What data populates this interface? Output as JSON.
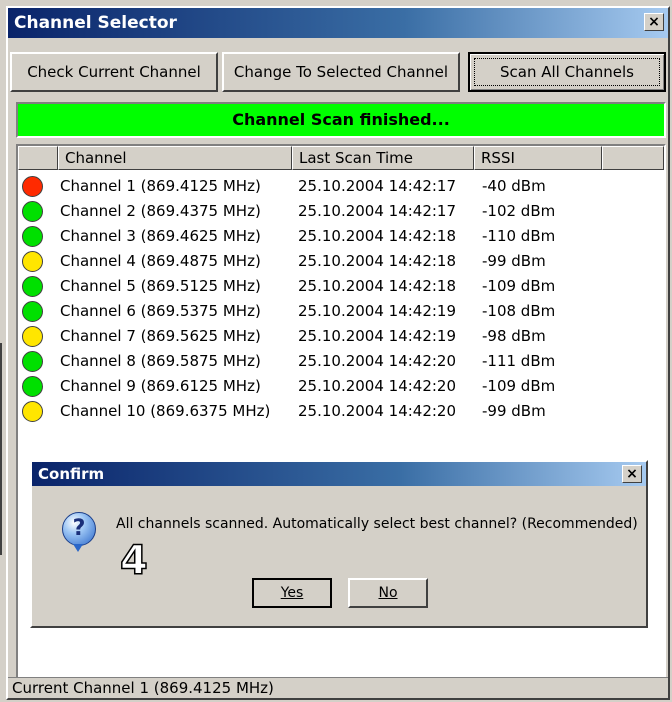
{
  "window": {
    "title": "Channel Selector",
    "close_glyph": "×"
  },
  "toolbar": {
    "check_label": "Check Current Channel",
    "change_label": "Change To Selected Channel",
    "scan_label": "Scan All Channels"
  },
  "scan_status": "Channel Scan finished...",
  "table": {
    "headers": [
      "Channel",
      "Last Scan Time",
      "RSSI",
      ""
    ],
    "rows": [
      {
        "status": "red",
        "channel": "Channel 1 (869.4125 MHz)",
        "time": "25.10.2004 14:42:17",
        "rssi": "-40 dBm"
      },
      {
        "status": "green",
        "channel": "Channel 2 (869.4375 MHz)",
        "time": "25.10.2004 14:42:17",
        "rssi": "-102 dBm"
      },
      {
        "status": "green",
        "channel": "Channel 3 (869.4625 MHz)",
        "time": "25.10.2004 14:42:18",
        "rssi": "-110 dBm"
      },
      {
        "status": "yellow",
        "channel": "Channel 4 (869.4875 MHz)",
        "time": "25.10.2004 14:42:18",
        "rssi": "-99 dBm"
      },
      {
        "status": "green",
        "channel": "Channel 5 (869.5125 MHz)",
        "time": "25.10.2004 14:42:18",
        "rssi": "-109 dBm"
      },
      {
        "status": "green",
        "channel": "Channel 6 (869.5375 MHz)",
        "time": "25.10.2004 14:42:19",
        "rssi": "-108 dBm"
      },
      {
        "status": "yellow",
        "channel": "Channel 7 (869.5625 MHz)",
        "time": "25.10.2004 14:42:19",
        "rssi": "-98 dBm"
      },
      {
        "status": "green",
        "channel": "Channel 8 (869.5875 MHz)",
        "time": "25.10.2004 14:42:20",
        "rssi": "-111 dBm"
      },
      {
        "status": "green",
        "channel": "Channel 9 (869.6125 MHz)",
        "time": "25.10.2004 14:42:20",
        "rssi": "-109 dBm"
      },
      {
        "status": "yellow",
        "channel": "Channel 10 (869.6375 MHz)",
        "time": "25.10.2004 14:42:20",
        "rssi": "-99 dBm"
      }
    ]
  },
  "colors": {
    "red": "#ff2a00",
    "green": "#00e000",
    "yellow": "#ffe600",
    "scan_bar": "#00ff00"
  },
  "dialog": {
    "title": "Confirm",
    "close_glyph": "×",
    "icon": "question-icon",
    "icon_glyph": "?",
    "message": "All channels scanned. Automatically select best channel? (Recommended)",
    "annotation": "4",
    "yes_label": "Yes",
    "no_label": "No"
  },
  "statusbar": {
    "text": "Current Channel 1 (869.4125 MHz)"
  }
}
